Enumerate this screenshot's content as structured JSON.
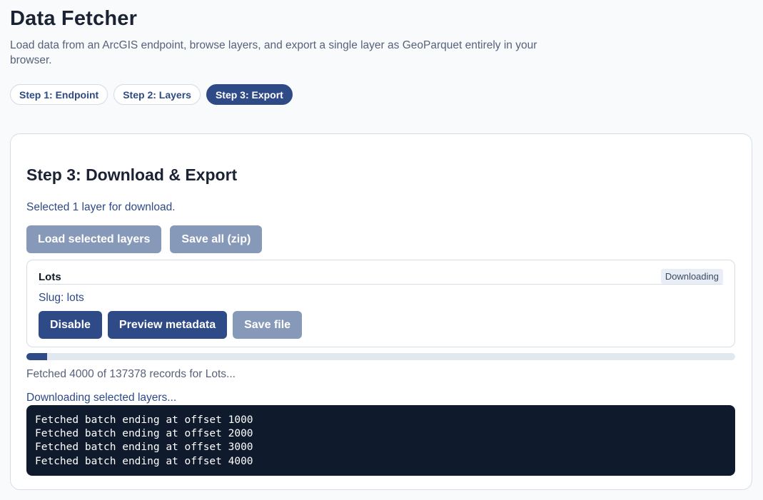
{
  "app": {
    "title": "Data Fetcher",
    "description": "Load data from an ArcGIS endpoint, browse layers, and export a single layer as GeoParquet entirely in your browser."
  },
  "steps": [
    {
      "label": "Step 1: Endpoint",
      "active": false
    },
    {
      "label": "Step 2: Layers",
      "active": false
    },
    {
      "label": "Step 3: Export",
      "active": true
    }
  ],
  "export": {
    "title": "Step 3: Download & Export",
    "selected_text": "Selected 1 layer for download.",
    "load_button": "Load selected layers",
    "save_all_button": "Save all (zip)"
  },
  "layer": {
    "name": "Lots",
    "status": "Downloading",
    "slug": "Slug: lots",
    "disable_button": "Disable",
    "preview_button": "Preview metadata",
    "save_button": "Save file"
  },
  "progress": {
    "fetched": 4000,
    "total": 137378,
    "text": "Fetched 4000 of 137378 records for Lots..."
  },
  "downloading_text": "Downloading selected layers...",
  "log_lines": [
    "Fetched batch ending at offset 1000",
    "Fetched batch ending at offset 2000",
    "Fetched batch ending at offset 3000",
    "Fetched batch ending at offset 4000"
  ],
  "colors": {
    "primary": "#2e4a87",
    "primary_disabled": "#8799b8",
    "console_bg": "#0f1b2d"
  }
}
